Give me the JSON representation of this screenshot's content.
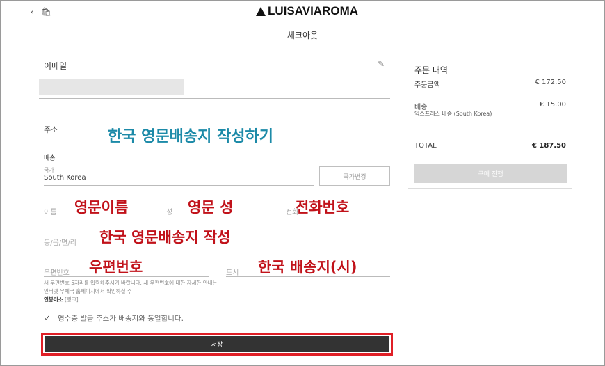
{
  "header": {
    "brand": "LUISAVIAROMA",
    "page_title": "체크아웃"
  },
  "email_section": {
    "title": "이메일"
  },
  "address_section": {
    "title": "주소",
    "shipping_label": "배송",
    "country_label": "국가",
    "country_value": "South Korea",
    "change_country_button": "국가변경",
    "first_name_placeholder": "이름",
    "last_name_placeholder": "성",
    "phone_placeholder": "전화",
    "address_placeholder": "동/읍/면/리",
    "postcode_placeholder": "우편번호",
    "city_placeholder": "도시",
    "postcode_note": "새 우편번호 5자리를 입력해주시기 바랍니다. 새 우편번호에 대한 자세한 안내는 인터넷 우체국 홈페이지에서 확인하실 수",
    "postcode_note_link": "인봉이소",
    "postcode_note_suffix": "[링크].",
    "billing_same_label": "영수증 발급 주소가 배송지와 동일합니다.",
    "save_button": "저장"
  },
  "annotations": {
    "main_title": "한국 영문배송지 작성하기",
    "first_name": "영문이름",
    "last_name": "영문 성",
    "phone": "전화번호",
    "address": "한국 영문배송지 작성",
    "postcode": "우편번호",
    "city": "한국 배송지(시)"
  },
  "order_summary": {
    "title": "주문 내역",
    "subtotal_label": "주문금액",
    "subtotal_value": "€ 172.50",
    "shipping_label": "배송",
    "shipping_method": "익스프레스 배송 (South Korea)",
    "shipping_value": "€ 15.00",
    "total_label": "TOTAL",
    "total_value": "€ 187.50",
    "pay_button": "구매 진행"
  }
}
